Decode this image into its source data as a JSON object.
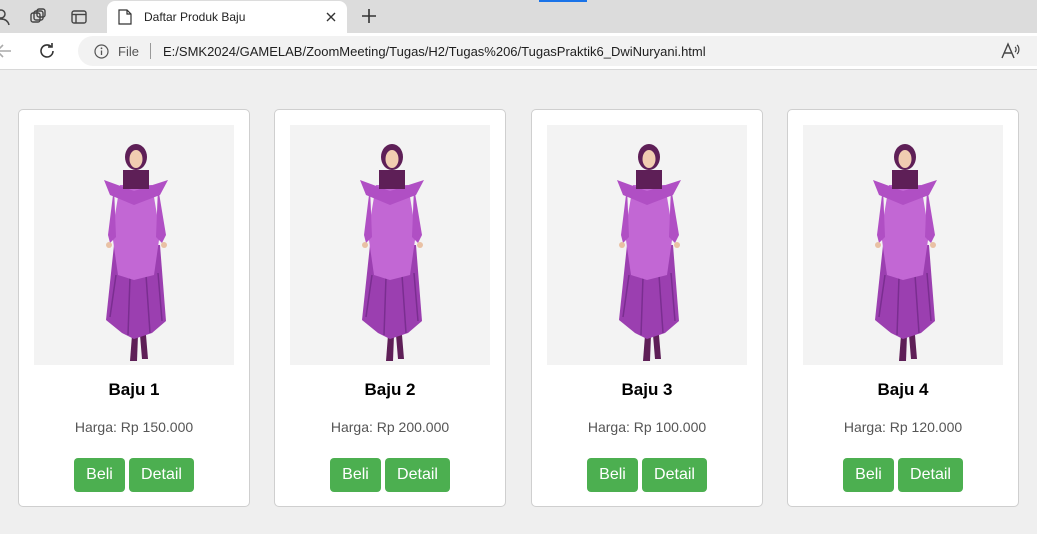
{
  "browser": {
    "tab_title": "Daftar Produk Baju",
    "file_label": "File",
    "url": "E:/SMK2024/GAMELAB/ZoomMeeting/Tugas/H2/Tugas%206/TugasPraktik6_DwiNuryani.html",
    "accent": "#1a73e8"
  },
  "products": [
    {
      "name": "Baju 1",
      "price": "Harga: Rp 150.000",
      "buy_label": "Beli",
      "detail_label": "Detail"
    },
    {
      "name": "Baju 2",
      "price": "Harga: Rp 200.000",
      "buy_label": "Beli",
      "detail_label": "Detail"
    },
    {
      "name": "Baju 3",
      "price": "Harga: Rp 100.000",
      "buy_label": "Beli",
      "detail_label": "Detail"
    },
    {
      "name": "Baju 4",
      "price": "Harga: Rp 120.000",
      "buy_label": "Beli",
      "detail_label": "Detail"
    }
  ],
  "colors": {
    "button": "#4caf50",
    "dress": "#b04fc4",
    "hijab": "#5e1f57"
  }
}
